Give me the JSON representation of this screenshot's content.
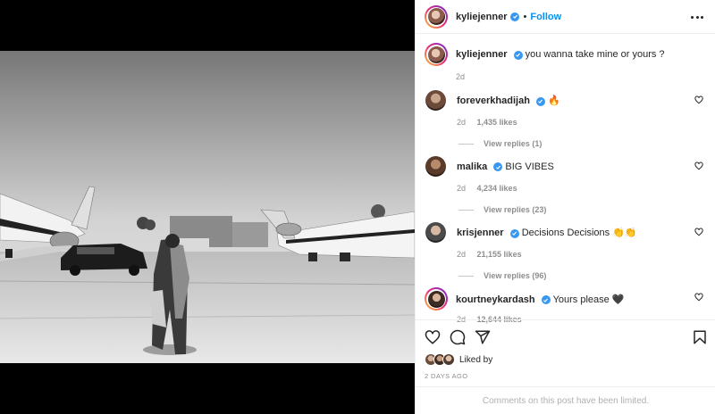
{
  "post": {
    "author": "kyliejenner",
    "follow_label": "Follow",
    "separator": "•"
  },
  "caption": {
    "username": "kyliejenner",
    "text": "you wanna take mine or yours ?",
    "time": "2d"
  },
  "comments": [
    {
      "username": "foreverkhadijah",
      "text": "🔥",
      "time": "2d",
      "likes": "1,435 likes",
      "replies": "View replies (1)"
    },
    {
      "username": "malika",
      "text": "BIG VIBES",
      "time": "2d",
      "likes": "4,234 likes",
      "replies": "View replies (23)"
    },
    {
      "username": "krisjenner",
      "text": "Decisions Decisions 👏👏",
      "time": "2d",
      "likes": "21,155 likes",
      "replies": "View replies (96)"
    },
    {
      "username": "kourtneykardash",
      "text": "Yours please 🖤",
      "time": "2d",
      "likes": "12,644 likes"
    }
  ],
  "likes_summary": "Liked by",
  "timestamp": "2 DAYS AGO",
  "comments_limited": "Comments on this post have been limited.",
  "icons": {
    "verified": "verified-badge-icon",
    "more": "more-options-icon",
    "like": "heart-icon",
    "comment": "comment-icon",
    "share": "share-icon",
    "save": "bookmark-icon"
  },
  "colors": {
    "accent": "#0095f6",
    "verified": "#3897f0",
    "muted": "#8e8e8e",
    "text": "#262626"
  }
}
